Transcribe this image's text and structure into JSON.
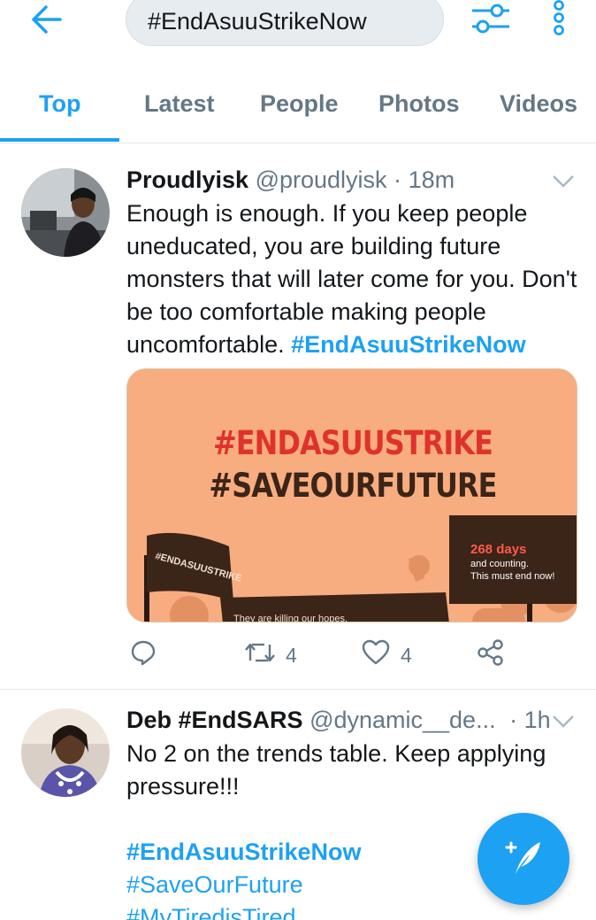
{
  "header": {
    "search_query": "#EndAsuuStrikeNow",
    "back_icon": "back-arrow-icon",
    "filter_icon": "filter-sliders-icon",
    "more_icon": "more-vertical-icon"
  },
  "tabs": [
    {
      "label": "Top",
      "active": true
    },
    {
      "label": "Latest",
      "active": false
    },
    {
      "label": "People",
      "active": false
    },
    {
      "label": "Photos",
      "active": false
    },
    {
      "label": "Videos",
      "active": false
    }
  ],
  "tweets": [
    {
      "name": "Proudlyisk",
      "handle": "@proudlyisk",
      "time": "18m",
      "text": "Enough is enough. If you keep people uneducated, you are building future monsters that will later come for you. Don't be too comfortable making people uncomfortable.",
      "hashtag": "#EndAsuuStrikeNow",
      "media": {
        "line1": "#ENDASUUSTRIKE",
        "line2": "#SAVEOURFUTURE",
        "flag_text": "#ENDASUUSTRIKE",
        "sign_title": "268 days",
        "sign_line1": "and counting.",
        "sign_line2": "This must end now!",
        "banner_text": "They are killing our hopes."
      },
      "retweets": "4",
      "likes": "4"
    },
    {
      "name": "Deb #EndSARS",
      "handle": "@dynamic__de...",
      "time": "1h",
      "text": "No 2 on the trends table. Keep applying pressure!!!",
      "hashtags": [
        "#EndAsuuStrikeNow",
        "#SaveOurFuture",
        "#MyTiredisTired"
      ]
    }
  ],
  "colors": {
    "accent": "#1da1f2",
    "muted": "#657786",
    "media_bg": "#f7ad7f",
    "poster_red": "#e0322c",
    "poster_dark": "#3b2418"
  }
}
